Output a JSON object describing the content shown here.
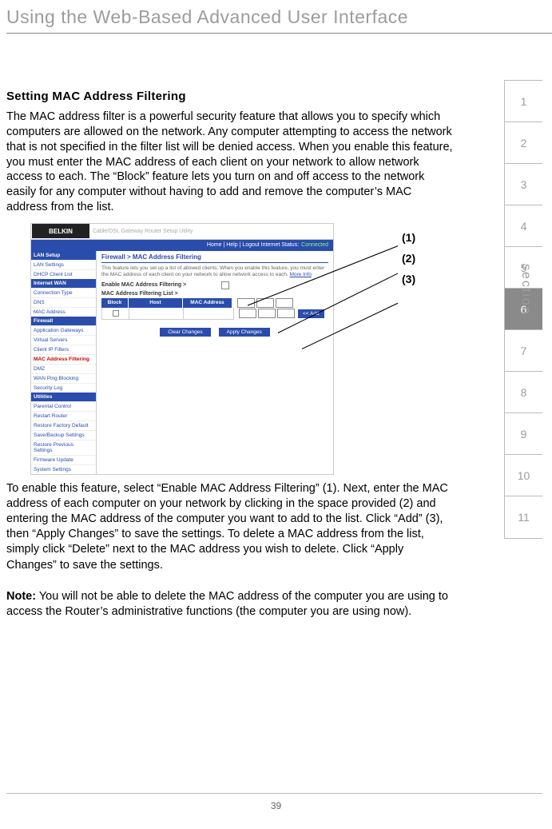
{
  "header": {
    "title": "Using the Web-Based Advanced User Interface"
  },
  "section": {
    "heading": "Setting MAC Address Filtering",
    "intro": "The MAC address filter is a powerful security feature that allows you to specify which computers are allowed on the network. Any computer attempting to access the network that is not specified in the filter list will be denied access. When you enable this feature, you must enter the MAC address of each client on your network to allow network access to each. The “Block” feature lets you turn on and off access to the network easily for any computer without having to add and remove the computer’s MAC address from the list.",
    "instructions": "To enable this feature, select “Enable MAC Address Filtering” (1). Next, enter the MAC address of each computer on your network by clicking in the space provided (2) and entering the MAC address of the computer you want to add to the list. Click “Add” (3), then “Apply Changes” to save the settings. To delete a MAC address from the list, simply click “Delete” next to the MAC address you wish to delete. Click “Apply Changes” to save the settings.",
    "note_label": "Note:",
    "note": " You will not be able to delete the MAC address of the computer you are using to access the Router’s administrative functions (the computer you are using now)."
  },
  "screenshot": {
    "logo": "BELKIN",
    "topcaption": "Cable/DSL Gateway Router Setup Utility",
    "statusbar_left": "Home | Help | Logout    Internet Status:",
    "statusbar_status": "Connected",
    "breadcrumb": "Firewall > MAC Address Filtering",
    "desc_prefix": "This feature lets you set up a list of allowed clients. When you enable this feature, you must enter the MAC address of each client on your network to allow network access to each. ",
    "desc_link": "More Info",
    "row_enable": "Enable MAC Address Filtering >",
    "row_list": "MAC Address Filtering List >",
    "th_block": "Block",
    "th_host": "Host",
    "th_mac": "MAC Address",
    "add_btn": "<< Add",
    "btn_clear": "Clear Changes",
    "btn_apply": "Apply Changes",
    "sidebar": {
      "groups": [
        {
          "header": "LAN Setup",
          "items": [
            "LAN Settings",
            "DHCP Client List"
          ]
        },
        {
          "header": "Internet WAN",
          "items": [
            "Connection Type",
            "DNS",
            "MAC Address"
          ]
        },
        {
          "header": "Firewall",
          "items": [
            "Application Gateways",
            "Virtual Servers",
            "Client IP Filters",
            "MAC Address Filtering",
            "DMZ",
            "WAN Ping Blocking",
            "Security Log"
          ]
        },
        {
          "header": "Utilities",
          "items": [
            "Parental Control",
            "Restart Router",
            "Restore Factory Default",
            "Save/Backup Settings",
            "Restore Previous Settings",
            "Firmware Update",
            "System Settings"
          ]
        }
      ],
      "active_item": "MAC Address Filtering"
    },
    "callouts": [
      "(1)",
      "(2)",
      "(3)"
    ]
  },
  "tabs": {
    "items": [
      "1",
      "2",
      "3",
      "4",
      "5",
      "6",
      "7",
      "8",
      "9",
      "10",
      "11"
    ],
    "active": "6",
    "label": "section"
  },
  "page_number": "39"
}
